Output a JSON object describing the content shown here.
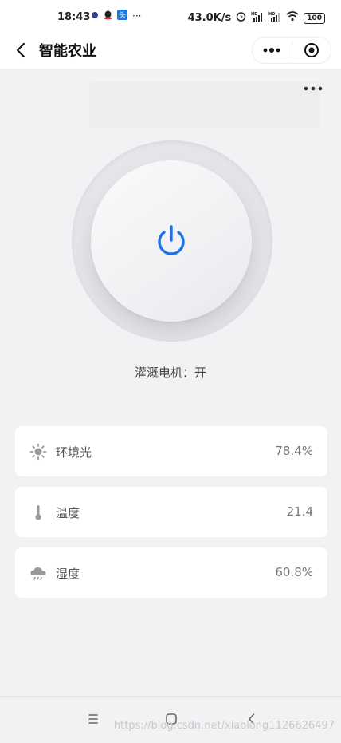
{
  "status_bar": {
    "time": "18:43",
    "network_speed": "43.0K/s",
    "signal_1": "HD",
    "signal_2": "HD",
    "battery": "100"
  },
  "nav": {
    "title": "智能农业"
  },
  "power": {
    "accent": "#1a73e8"
  },
  "motor": {
    "label": "灌溉电机：",
    "state": "开"
  },
  "sensors": [
    {
      "label": "环境光",
      "value": "78.4%",
      "icon": "sun-icon"
    },
    {
      "label": "温度",
      "value": "21.4",
      "icon": "thermometer-icon"
    },
    {
      "label": "湿度",
      "value": "60.8%",
      "icon": "rain-cloud-icon"
    }
  ],
  "watermark": "https://blog.csdn.net/xiaolong1126626497"
}
